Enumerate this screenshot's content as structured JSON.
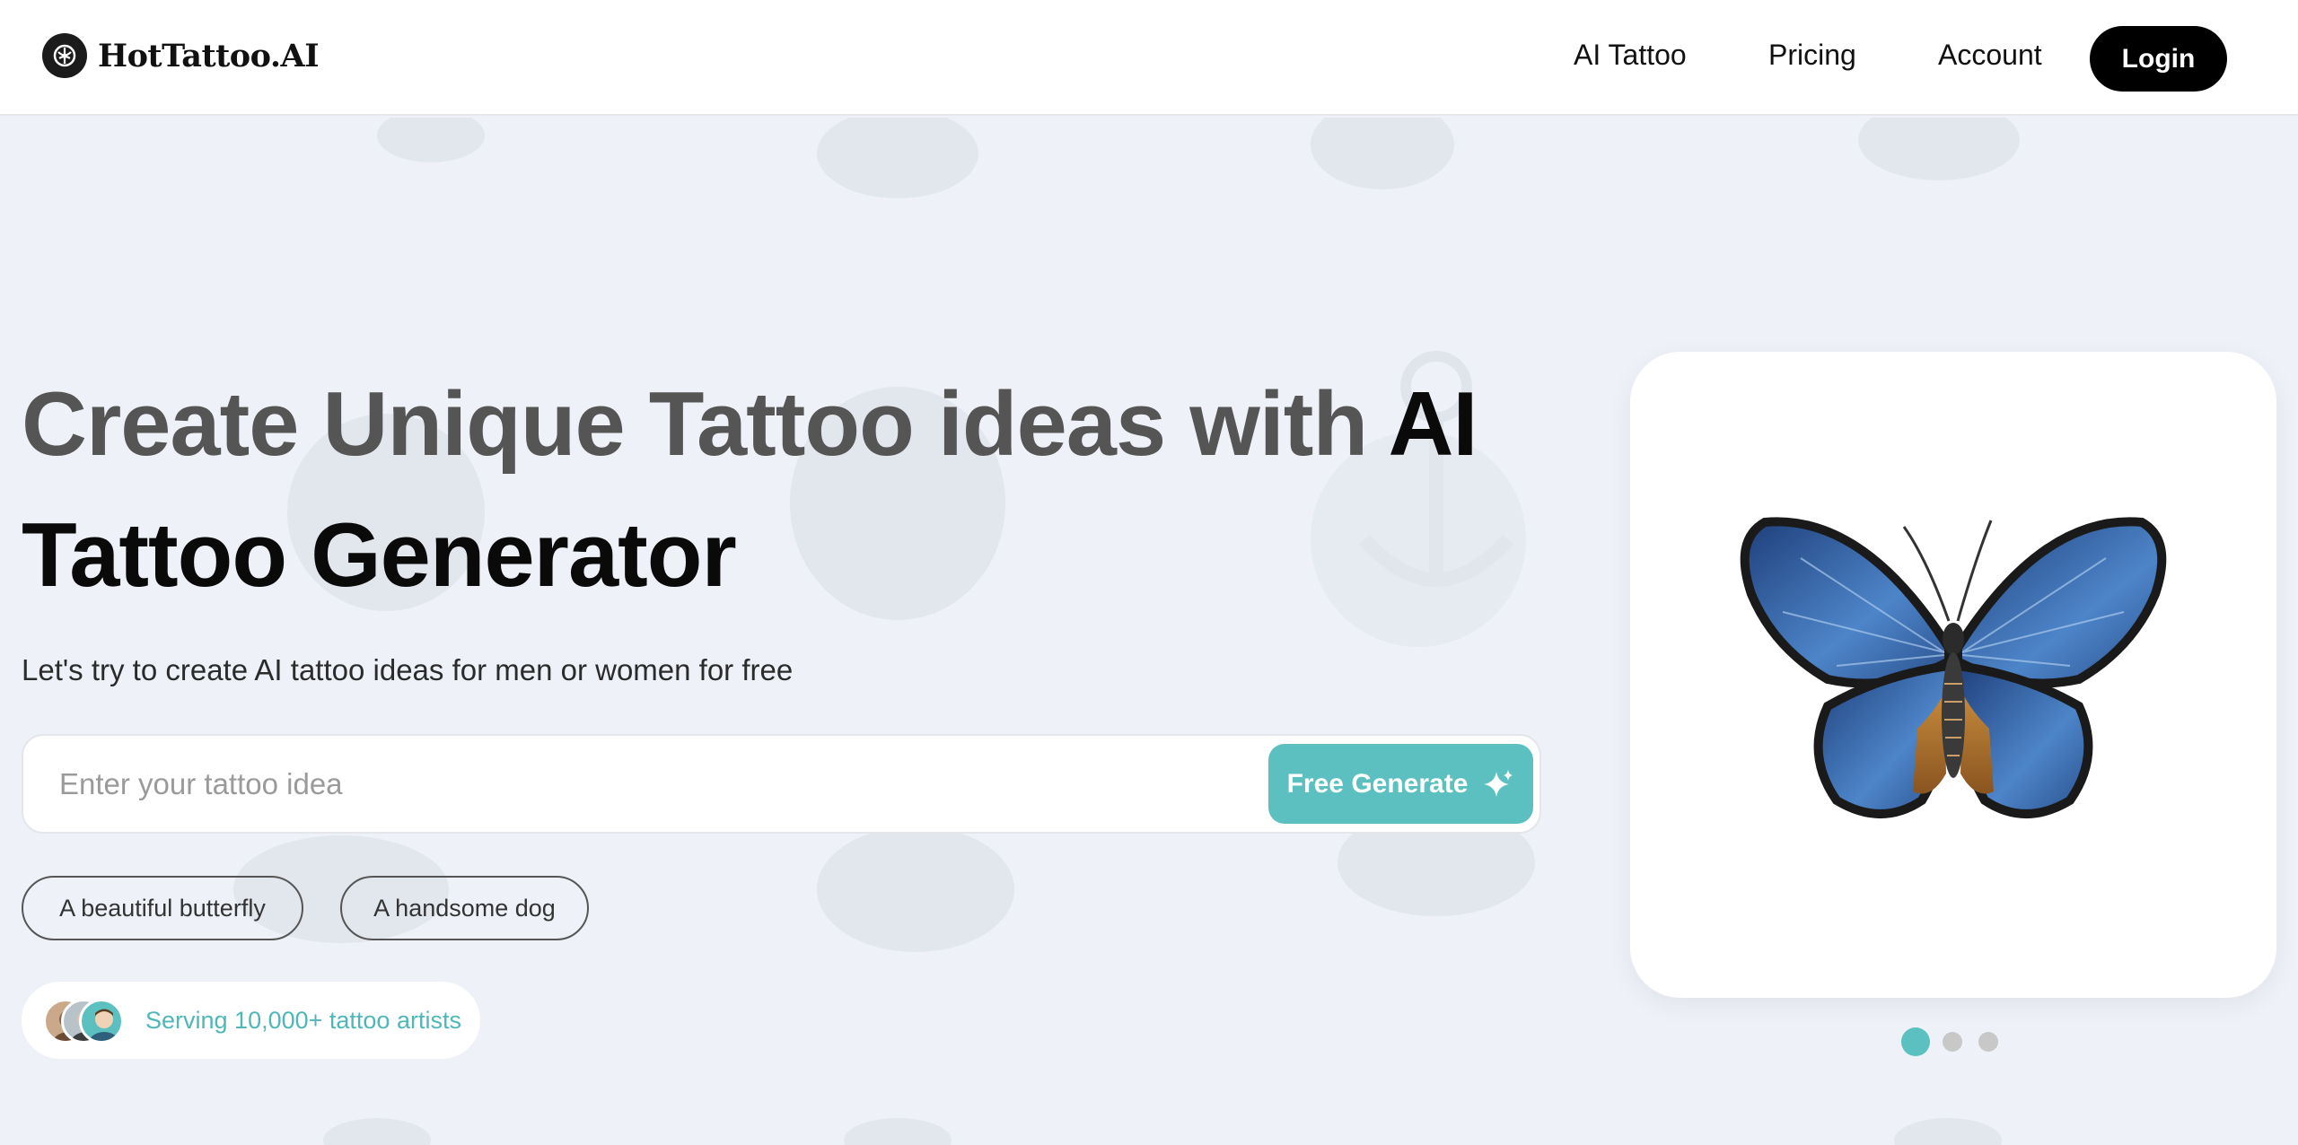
{
  "header": {
    "brand_name": "HotTattoo.AI",
    "nav": [
      {
        "label": "AI Tattoo"
      },
      {
        "label": "Pricing"
      },
      {
        "label": "Account"
      }
    ],
    "login_label": "Login"
  },
  "hero": {
    "title_part1": "Create Unique Tattoo ideas with ",
    "title_part2": "AI Tattoo Generator",
    "subtitle": "Let's try to create AI tattoo ideas for men or women for free",
    "search": {
      "placeholder": "Enter your tattoo idea",
      "value": "",
      "button_label": "Free Generate"
    },
    "suggestions": [
      "A beautiful butterfly",
      "A handsome dog"
    ],
    "social_proof": "Serving 10,000+ tattoo artists"
  },
  "carousel": {
    "image": "butterfly-tattoo",
    "slides": 3,
    "active_index": 0
  },
  "colors": {
    "accent": "#5cc0c0",
    "title_muted": "#555555",
    "title_strong": "#0a0a0a",
    "background": "#eef2f8"
  }
}
